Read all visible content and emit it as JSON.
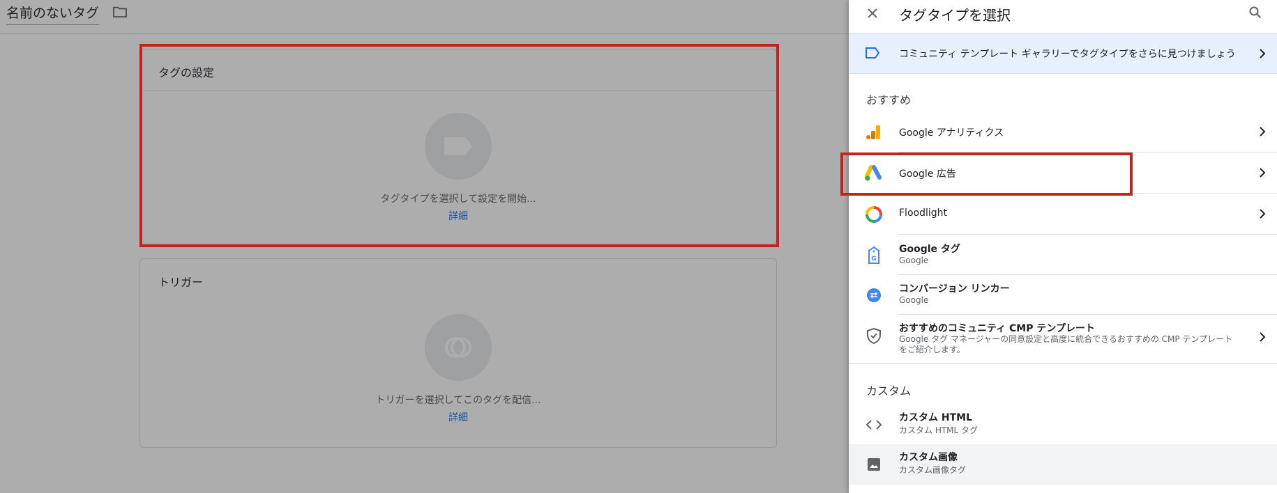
{
  "editor": {
    "tag_name": "名前のないタグ",
    "config_card": {
      "title": "タグの設定",
      "hint": "タグタイプを選択して設定を開始...",
      "link": "詳細"
    },
    "trigger_card": {
      "title": "トリガー",
      "hint": "トリガーを選択してこのタグを配信...",
      "link": "詳細"
    }
  },
  "panel": {
    "title": "タグタイプを選択",
    "gallery_banner": "コミュニティ テンプレート ギャラリーでタグタイプをさらに見つけましょう",
    "recommended_label": "おすすめ",
    "custom_label": "カスタム",
    "items": {
      "ga": {
        "title": "Google アナリティクス"
      },
      "gads": {
        "title": "Google 広告"
      },
      "floodlight": {
        "title": "Floodlight"
      },
      "gtag": {
        "title": "Google タグ",
        "sub": "Google"
      },
      "conv": {
        "title": "コンバージョン リンカー",
        "sub": "Google"
      },
      "cmp": {
        "title": "おすすめのコミュニティ CMP テンプレート",
        "desc": "Google タグ マネージャーの同意設定と高度に統合できるおすすめの CMP テンプレートをご紹介します。"
      },
      "html": {
        "title": "カスタム HTML",
        "sub": "カスタム HTML タグ"
      },
      "img": {
        "title": "カスタム画像",
        "sub": "カスタム画像タグ"
      }
    }
  },
  "colors": {
    "highlight": "#c5221f",
    "link": "#1a73e8",
    "banner_bg": "#e8f0fe"
  }
}
